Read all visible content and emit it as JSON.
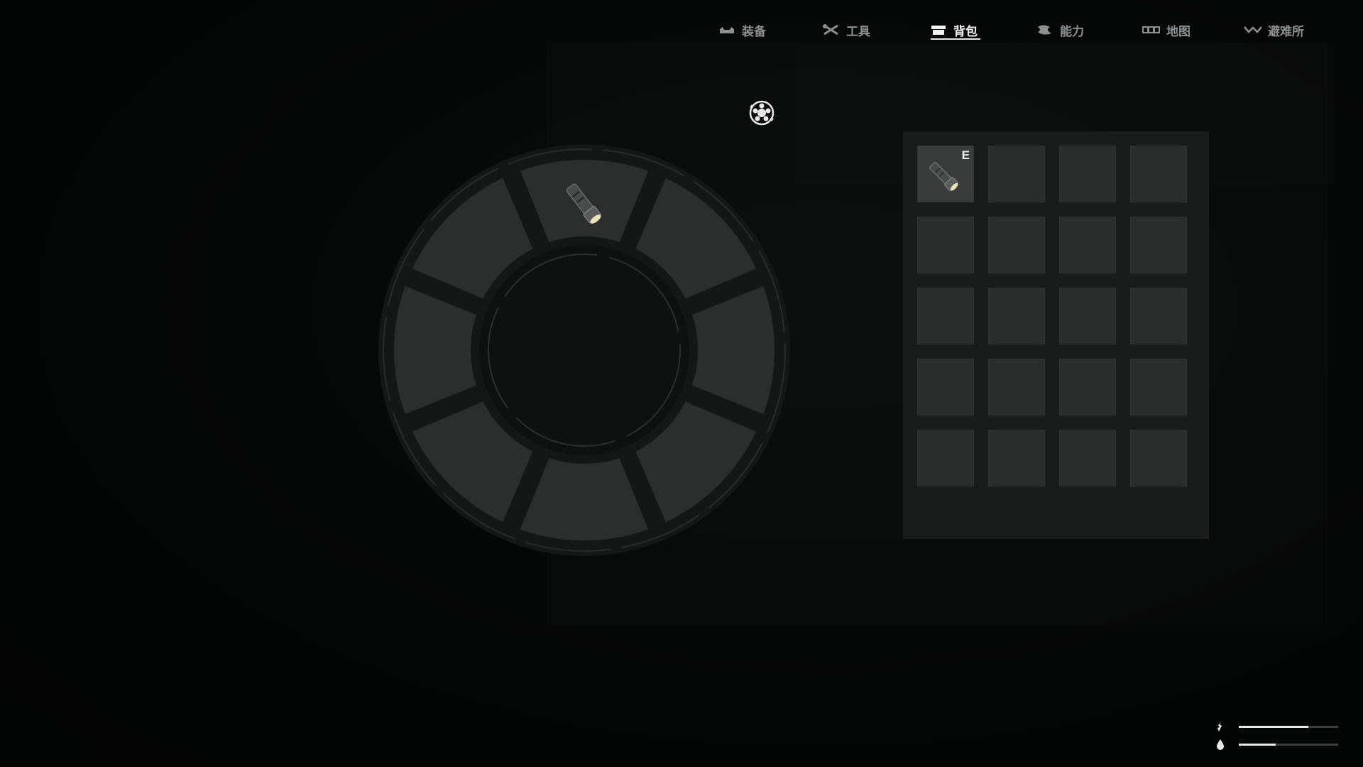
{
  "tabs": [
    {
      "label": "装备",
      "icon": "equipment-icon",
      "active": false
    },
    {
      "label": "工具",
      "icon": "tools-icon",
      "active": false
    },
    {
      "label": "背包",
      "icon": "backpack-icon",
      "active": true
    },
    {
      "label": "能力",
      "icon": "ability-icon",
      "active": false
    },
    {
      "label": "地图",
      "icon": "map-icon",
      "active": false
    },
    {
      "label": "避难所",
      "icon": "shelter-icon",
      "active": false
    }
  ],
  "control_icon": "rotate-control-icon",
  "wheel": {
    "segments": 8,
    "equipped_segment": 0,
    "equipped_item_icon": "flashlight-icon"
  },
  "inventory": {
    "rows": 5,
    "cols": 4,
    "slot_0": {
      "item_icon": "flashlight-icon",
      "key_hint": "E"
    }
  },
  "status": {
    "stamina": {
      "icon": "stamina-icon",
      "level": 0.7
    },
    "hydration": {
      "icon": "water-drop-icon",
      "level": 0.37
    }
  },
  "colors": {
    "background": "#050606",
    "segment": "#2c2d2d",
    "panel": "#1a1b1b",
    "slot": "#2b2c2c",
    "active_text": "#f2f2f2",
    "inactive_text": "#8b9090"
  }
}
